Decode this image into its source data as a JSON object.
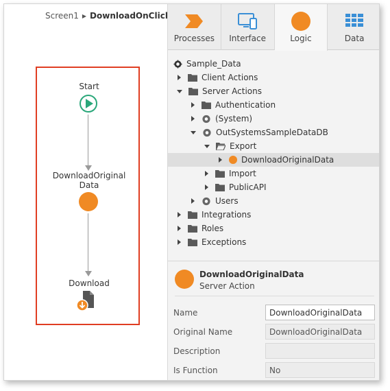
{
  "breadcrumb": {
    "screen": "Screen1",
    "current": "DownloadOnClick"
  },
  "flow": {
    "start_label": "Start",
    "action_label_line1": "DownloadOriginal",
    "action_label_line2": "Data",
    "download_label": "Download"
  },
  "tabs": [
    {
      "label": "Processes",
      "icon": "processes-icon"
    },
    {
      "label": "Interface",
      "icon": "interface-icon"
    },
    {
      "label": "Logic",
      "icon": "logic-icon",
      "active": true
    },
    {
      "label": "Data",
      "icon": "data-icon"
    }
  ],
  "tree": {
    "root": "Sample_Data",
    "items": [
      {
        "label": "Client Actions",
        "icon": "folder-icon"
      },
      {
        "label": "Server Actions",
        "icon": "folder-icon"
      },
      {
        "label": "Authentication",
        "icon": "folder-icon"
      },
      {
        "label": "(System)",
        "icon": "module-icon"
      },
      {
        "label": "OutSystemsSampleDataDB",
        "icon": "module-icon"
      },
      {
        "label": "Export",
        "icon": "open-folder-icon"
      },
      {
        "label": "DownloadOriginalData",
        "icon": "server-action-icon",
        "selected": true
      },
      {
        "label": "Import",
        "icon": "folder-icon"
      },
      {
        "label": "PublicAPI",
        "icon": "folder-icon"
      },
      {
        "label": "Users",
        "icon": "module-icon"
      },
      {
        "label": "Integrations",
        "icon": "folder-icon"
      },
      {
        "label": "Roles",
        "icon": "folder-icon"
      },
      {
        "label": "Exceptions",
        "icon": "folder-icon"
      }
    ]
  },
  "details": {
    "title": "DownloadOriginalData",
    "subtitle": "Server Action",
    "properties": [
      {
        "name": "Name",
        "value": "DownloadOriginalData"
      },
      {
        "name": "Original Name",
        "value": "DownloadOriginalData"
      },
      {
        "name": "Description",
        "value": ""
      },
      {
        "name": "Is Function",
        "value": "No"
      }
    ]
  },
  "colors": {
    "accent_orange": "#f08a24",
    "start_green": "#2aa77a",
    "highlight_red": "#e03d22",
    "tab_blue": "#3a8fd6"
  }
}
